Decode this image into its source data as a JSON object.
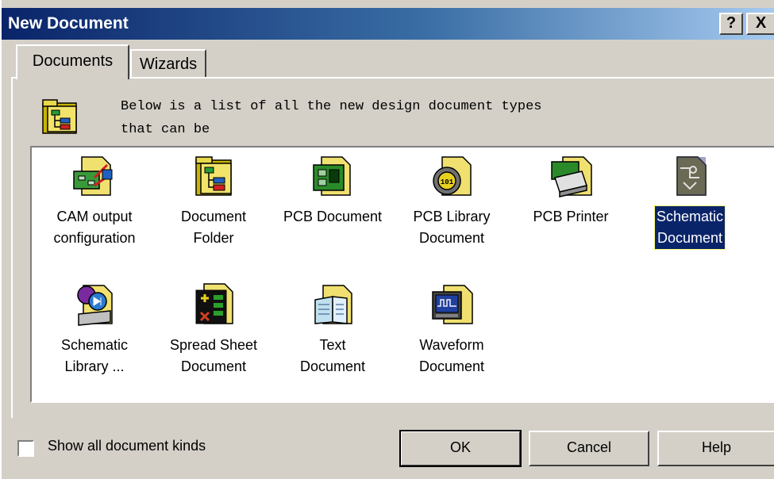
{
  "window": {
    "title": "New Document",
    "help_glyph": "?",
    "close_glyph": "X"
  },
  "tabs": [
    {
      "label": "Documents",
      "active": true
    },
    {
      "label": "Wizards",
      "active": false
    }
  ],
  "description": {
    "line1": "Below is a list of all the new design document types",
    "line2": "that can be"
  },
  "documents": [
    {
      "label": "CAM output\nconfiguration",
      "icon": "cam-output-icon",
      "selected": false
    },
    {
      "label": "Document\nFolder",
      "icon": "document-folder-icon",
      "selected": false
    },
    {
      "label": "PCB Document",
      "icon": "pcb-document-icon",
      "selected": false
    },
    {
      "label": "PCB Library\nDocument",
      "icon": "pcb-library-icon",
      "selected": false
    },
    {
      "label": "PCB Printer",
      "icon": "pcb-printer-icon",
      "selected": false
    },
    {
      "label": "Schematic\nDocument",
      "icon": "schematic-document-icon",
      "selected": true
    },
    {
      "label": "Schematic\nLibrary ...",
      "icon": "schematic-library-icon",
      "selected": false
    },
    {
      "label": "Spread Sheet\nDocument",
      "icon": "spreadsheet-icon",
      "selected": false
    },
    {
      "label": "Text\nDocument",
      "icon": "text-document-icon",
      "selected": false
    },
    {
      "label": "Waveform\nDocument",
      "icon": "waveform-document-icon",
      "selected": false
    }
  ],
  "footer": {
    "checkbox_label": "Show all document kinds",
    "checkbox_checked": false,
    "ok_label": "OK",
    "cancel_label": "Cancel",
    "help_label": "Help"
  },
  "colors": {
    "title_bar": "#0a246a",
    "selection": "#0a246a",
    "face": "#d4d0c8"
  }
}
